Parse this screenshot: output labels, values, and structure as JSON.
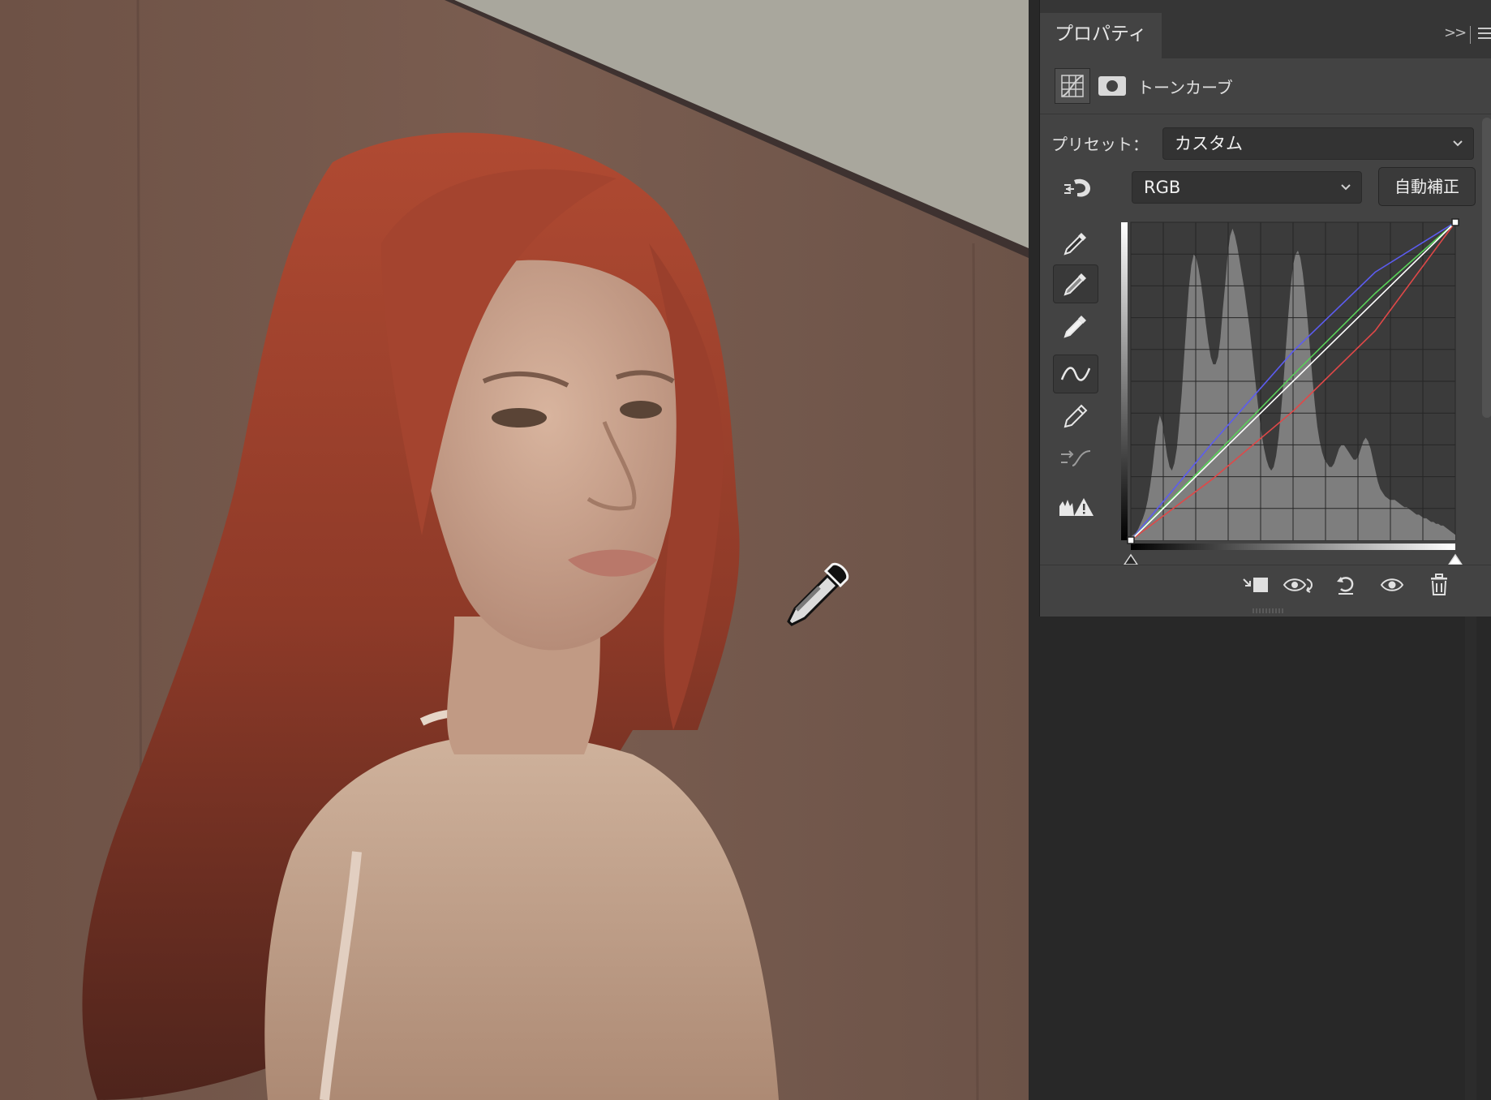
{
  "panel": {
    "tab_label": "プロパティ",
    "collapse_icon_text": ">>",
    "adjustment_title": "トーンカーブ",
    "preset_label": "プリセット：",
    "preset_value": "カスタム",
    "channel_value": "RGB",
    "auto_button_label": "自動補正"
  },
  "tools": [
    {
      "name": "sample-shadow-eyedropper-icon",
      "active": false
    },
    {
      "name": "sample-midtone-eyedropper-icon",
      "active": true
    },
    {
      "name": "sample-highlight-eyedropper-icon",
      "active": false
    },
    {
      "name": "edit-points-curve-icon",
      "active": true
    },
    {
      "name": "draw-pencil-icon",
      "active": false
    },
    {
      "name": "smooth-curve-icon",
      "active": false
    },
    {
      "name": "clipping-warning-icon",
      "active": false
    }
  ],
  "bottom_bar": [
    "clip-to-layer-icon",
    "view-previous-state-icon",
    "reset-icon",
    "toggle-visibility-icon",
    "delete-icon"
  ],
  "colors": {
    "panel_bg": "#434343",
    "graph_bg": "#3b3b3b",
    "histogram": "#7e7e7e",
    "curve_rgb": "#ffffff",
    "curve_red": "#e04848",
    "curve_green": "#58d058",
    "curve_blue": "#5c5cf0"
  },
  "chart_data": {
    "type": "line",
    "xlim": [
      0,
      255
    ],
    "ylim": [
      0,
      255
    ],
    "grid": true,
    "series": [
      {
        "channel": "rgb",
        "x": [
          0,
          255
        ],
        "y": [
          0,
          255
        ]
      },
      {
        "channel": "red",
        "x": [
          0,
          64,
          128,
          192,
          255
        ],
        "y": [
          0,
          49,
          104,
          168,
          255
        ]
      },
      {
        "channel": "green",
        "x": [
          0,
          64,
          128,
          192,
          255
        ],
        "y": [
          0,
          66,
          133,
          198,
          255
        ]
      },
      {
        "channel": "blue",
        "x": [
          0,
          64,
          128,
          192,
          255
        ],
        "y": [
          0,
          78,
          152,
          215,
          255
        ]
      }
    ],
    "histogram": [
      2,
      3,
      4,
      6,
      9,
      12,
      16,
      22,
      30,
      40,
      52,
      62,
      68,
      64,
      55,
      46,
      40,
      38,
      42,
      50,
      64,
      80,
      100,
      120,
      138,
      150,
      156,
      154,
      148,
      140,
      130,
      118,
      108,
      100,
      96,
      96,
      100,
      110,
      126,
      140,
      156,
      166,
      170,
      166,
      160,
      152,
      144,
      136,
      126,
      116,
      104,
      92,
      80,
      68,
      58,
      50,
      44,
      40,
      38,
      40,
      46,
      56,
      70,
      86,
      104,
      122,
      138,
      150,
      156,
      158,
      154,
      146,
      134,
      120,
      104,
      88,
      74,
      62,
      54,
      48,
      44,
      42,
      40,
      40,
      42,
      46,
      50,
      52,
      52,
      50,
      48,
      46,
      44,
      44,
      46,
      50,
      54,
      56,
      54,
      50,
      44,
      38,
      32,
      28,
      26,
      24,
      23,
      22,
      22,
      22,
      21,
      20,
      19,
      18,
      18,
      17,
      16,
      15,
      14,
      14,
      13,
      12,
      12,
      11,
      10,
      10,
      9,
      9,
      8,
      8,
      7,
      6,
      5,
      4,
      3
    ]
  }
}
